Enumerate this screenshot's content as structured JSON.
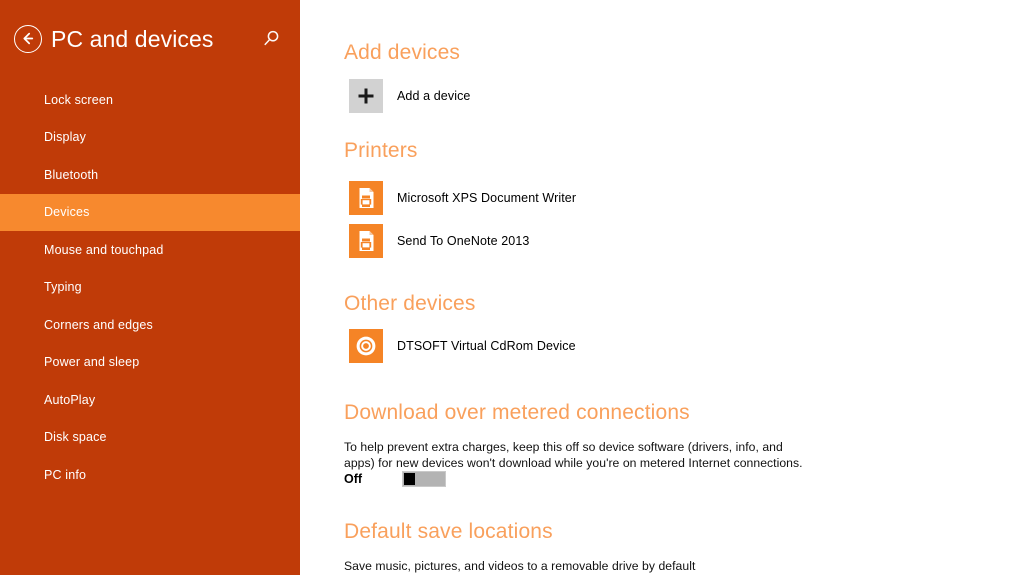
{
  "sidebar": {
    "back_icon": "back-arrow-circle-icon",
    "title": "PC and devices",
    "search_icon": "search-icon",
    "items": [
      {
        "label": "Lock screen",
        "selected": false
      },
      {
        "label": "Display",
        "selected": false
      },
      {
        "label": "Bluetooth",
        "selected": false
      },
      {
        "label": "Devices",
        "selected": true
      },
      {
        "label": "Mouse and touchpad",
        "selected": false
      },
      {
        "label": "Typing",
        "selected": false
      },
      {
        "label": "Corners and edges",
        "selected": false
      },
      {
        "label": "Power and sleep",
        "selected": false
      },
      {
        "label": "AutoPlay",
        "selected": false
      },
      {
        "label": "Disk space",
        "selected": false
      },
      {
        "label": "PC info",
        "selected": false
      }
    ],
    "colors": {
      "background": "#c03b08",
      "selected": "#f7892e",
      "text": "#ffffff"
    }
  },
  "content": {
    "add_devices": {
      "heading": "Add devices",
      "add_button_label": "Add a device",
      "add_button_icon": "plus-icon"
    },
    "printers": {
      "heading": "Printers",
      "items": [
        {
          "label": "Microsoft XPS Document Writer",
          "icon": "printer-icon"
        },
        {
          "label": "Send To OneNote 2013",
          "icon": "printer-icon"
        }
      ]
    },
    "other_devices": {
      "heading": "Other devices",
      "items": [
        {
          "label": "DTSOFT Virtual CdRom Device",
          "icon": "cd-drive-icon"
        }
      ]
    },
    "metered": {
      "heading": "Download over metered connections",
      "description": "To help prevent extra charges, keep this off so device software (drivers, info, and apps) for new devices won't download while you're on metered Internet connections.",
      "toggle_state": "Off"
    },
    "default_save": {
      "heading": "Default save locations",
      "description": "Save music, pictures, and videos to a removable drive by default"
    },
    "colors": {
      "heading": "#f9a05c",
      "tile_orange": "#f58426",
      "tile_gray": "#d2d2d2",
      "body_text": "#111111"
    }
  }
}
